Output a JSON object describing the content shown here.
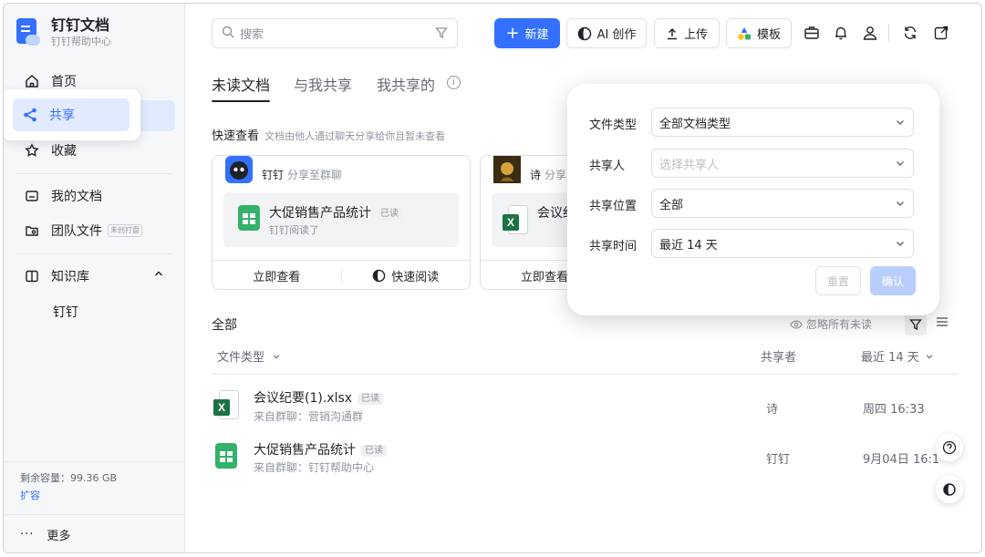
{
  "brand": {
    "title": "钉钉文档",
    "subtitle": "钉钉帮助中心"
  },
  "sidebar": {
    "items": [
      {
        "label": "首页"
      },
      {
        "label": "共享"
      },
      {
        "label": "收藏"
      },
      {
        "label": "我的文档"
      },
      {
        "label": "团队文件",
        "tag": "未创打盘"
      },
      {
        "label": "知识库"
      }
    ],
    "kb_sub": "钉钉",
    "storage": "剩余容量：99.36 GB",
    "expand": "扩容",
    "more": "更多"
  },
  "topbar": {
    "search_placeholder": "搜索",
    "new_label": "新建",
    "ai_label": "AI 创作",
    "upload_label": "上传",
    "template_label": "模板"
  },
  "tabs": [
    {
      "label": "未读文档"
    },
    {
      "label": "与我共享"
    },
    {
      "label": "我共享的"
    }
  ],
  "quick_view": {
    "title": "快速查看",
    "hint": "文档由他人通过聊天分享给你且暂未查看"
  },
  "cards": [
    {
      "sharer": "钉钉",
      "action": "分享至群聊",
      "file": "大促销售产品统计",
      "read_tag": "已读",
      "sub": "钉钉阅读了",
      "btn_view": "立即查看",
      "btn_quick": "快速阅读"
    },
    {
      "sharer": "诗",
      "action": "分享",
      "file": "会议纪",
      "btn_view": "立即查看"
    }
  ],
  "all": {
    "title": "全部",
    "ignore_all": "忽略所有未读",
    "col_type": "文件类型",
    "col_sharer": "共享者",
    "col_time": "最近 14 天",
    "rows": [
      {
        "name": "会议纪要(1).xlsx",
        "tag": "已读",
        "src": "来自群聊：营销沟通群",
        "sharer": "诗",
        "time": "周四 16:33"
      },
      {
        "name": "大促销售产品统计",
        "tag": "已读",
        "src": "来自群聊：钉钉帮助中心",
        "sharer": "钉钉",
        "time": "9月04日 16:1"
      }
    ]
  },
  "filter": {
    "type_label": "文件类型",
    "type_value": "全部文档类型",
    "sharer_label": "共享人",
    "sharer_placeholder": "选择共享人",
    "location_label": "共享位置",
    "location_value": "全部",
    "time_label": "共享时间",
    "time_value": "最近 14 天",
    "reset": "重置",
    "confirm": "确认"
  },
  "colors": {
    "accent": "#3370ff",
    "active_bg": "#e1eaff",
    "sheet_green": "#34b16a",
    "excel_green": "#1e7145"
  }
}
